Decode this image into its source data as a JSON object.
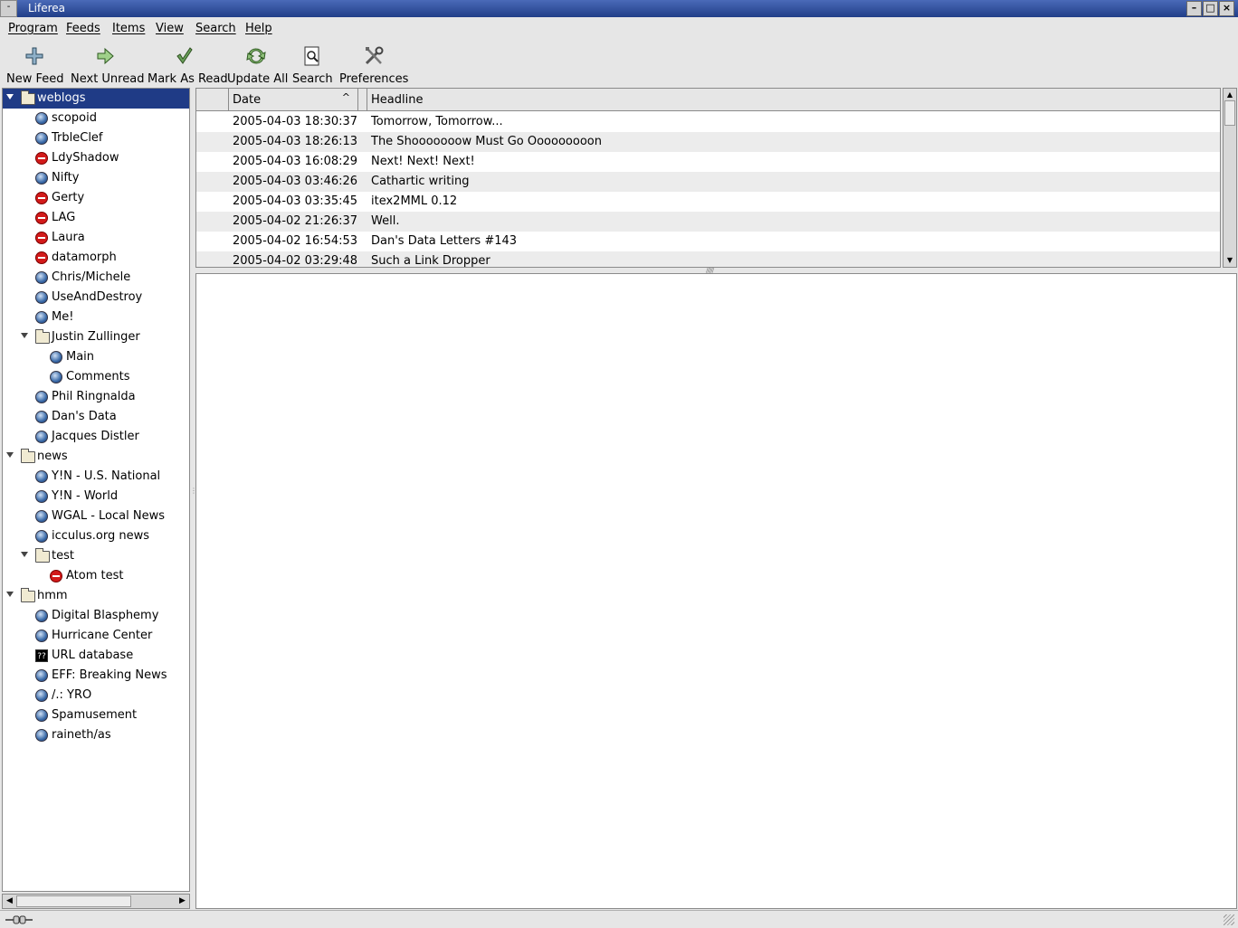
{
  "window": {
    "title": "Liferea"
  },
  "menu": [
    "Program",
    "Feeds",
    "Items",
    "View",
    "Search",
    "Help"
  ],
  "toolbar": [
    {
      "label": "New Feed",
      "icon": "plus-icon"
    },
    {
      "label": "Next Unread",
      "icon": "arrow-right-icon"
    },
    {
      "label": "Mark As Read",
      "icon": "checkmark-icon"
    },
    {
      "label": "Update All",
      "icon": "refresh-icon"
    },
    {
      "label": "Search",
      "icon": "search-icon"
    },
    {
      "label": "Preferences",
      "icon": "tools-icon"
    }
  ],
  "feeds": [
    {
      "label": "weblogs",
      "type": "folder",
      "level": 0,
      "selected": true
    },
    {
      "label": "scopoid",
      "type": "feed",
      "level": 1
    },
    {
      "label": "TrbleClef",
      "type": "feed",
      "level": 1
    },
    {
      "label": "LdyShadow",
      "type": "error",
      "level": 1
    },
    {
      "label": "Nifty",
      "type": "feed",
      "level": 1
    },
    {
      "label": "Gerty",
      "type": "error",
      "level": 1
    },
    {
      "label": "LAG",
      "type": "error",
      "level": 1
    },
    {
      "label": "Laura",
      "type": "error",
      "level": 1
    },
    {
      "label": "datamorph",
      "type": "error",
      "level": 1
    },
    {
      "label": "Chris/Michele",
      "type": "feed",
      "level": 1
    },
    {
      "label": "UseAndDestroy",
      "type": "feed",
      "level": 1
    },
    {
      "label": "Me!",
      "type": "feed",
      "level": 1
    },
    {
      "label": "Justin Zullinger",
      "type": "folder",
      "level": 1
    },
    {
      "label": "Main",
      "type": "feed",
      "level": 2
    },
    {
      "label": "Comments",
      "type": "feed",
      "level": 2
    },
    {
      "label": "Phil Ringnalda",
      "type": "feed",
      "level": 1
    },
    {
      "label": "Dan's Data",
      "type": "feed",
      "level": 1
    },
    {
      "label": "Jacques Distler",
      "type": "feed",
      "level": 1
    },
    {
      "label": "news",
      "type": "folder",
      "level": 0
    },
    {
      "label": "Y!N - U.S. National",
      "type": "feed",
      "level": 1
    },
    {
      "label": "Y!N - World",
      "type": "feed",
      "level": 1
    },
    {
      "label": "WGAL - Local News",
      "type": "feed",
      "level": 1
    },
    {
      "label": "icculus.org news",
      "type": "feed",
      "level": 1
    },
    {
      "label": "test",
      "type": "folder",
      "level": 1
    },
    {
      "label": "Atom test",
      "type": "error",
      "level": 2
    },
    {
      "label": "hmm",
      "type": "folder",
      "level": 0
    },
    {
      "label": "Digital Blasphemy",
      "type": "feed",
      "level": 1
    },
    {
      "label": "Hurricane Center",
      "type": "feed",
      "level": 1
    },
    {
      "label": "URL database",
      "type": "unknown",
      "level": 1,
      "icon_text": "??"
    },
    {
      "label": "EFF: Breaking News",
      "type": "feed",
      "level": 1
    },
    {
      "label": "/.: YRO",
      "type": "feed",
      "level": 1
    },
    {
      "label": "Spamusement",
      "type": "feed",
      "level": 1
    },
    {
      "label": "raineth/as",
      "type": "feed",
      "level": 1
    }
  ],
  "items": {
    "columns": {
      "date": "Date",
      "headline": "Headline"
    },
    "rows": [
      {
        "date": "2005-04-03 18:30:37",
        "headline": "Tomorrow, Tomorrow..."
      },
      {
        "date": "2005-04-03 18:26:13",
        "headline": "The Shooooooow Must Go Ooooooooon"
      },
      {
        "date": "2005-04-03 16:08:29",
        "headline": "Next! Next! Next!"
      },
      {
        "date": "2005-04-03 03:46:26",
        "headline": "Cathartic writing"
      },
      {
        "date": "2005-04-03 03:35:45",
        "headline": "itex2MML 0.12"
      },
      {
        "date": "2005-04-02 21:26:37",
        "headline": "Well."
      },
      {
        "date": "2005-04-02 16:54:53",
        "headline": "Dan's Data Letters #143"
      },
      {
        "date": "2005-04-02 03:29:48",
        "headline": "Such a Link Dropper"
      }
    ]
  },
  "colors": {
    "selection": "#1f3b86",
    "titlebar": "#2a4690",
    "error_icon": "#d21a1a"
  }
}
